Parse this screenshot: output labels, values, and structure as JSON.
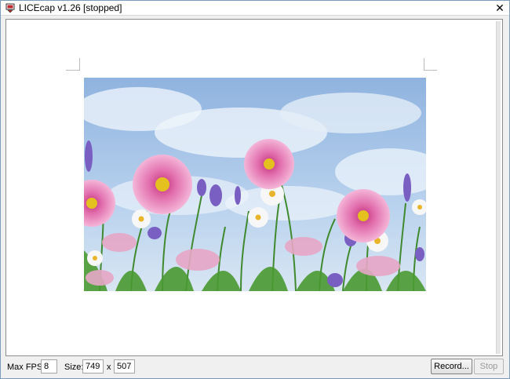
{
  "window": {
    "title": "LICEcap v1.26 [stopped]",
    "close_glyph": "✕"
  },
  "icons": {
    "app": "licecap-app-icon",
    "close": "close-icon"
  },
  "controls": {
    "fps_label": "Max FPS:",
    "fps_value": "8",
    "size_label": "Size:",
    "width_value": "749",
    "times_label": "x",
    "height_value": "507",
    "record_label": "Record...",
    "stop_label": "Stop"
  },
  "colors": {
    "frame_border": "#7a9cbf",
    "accent_red": "#c0282d"
  }
}
